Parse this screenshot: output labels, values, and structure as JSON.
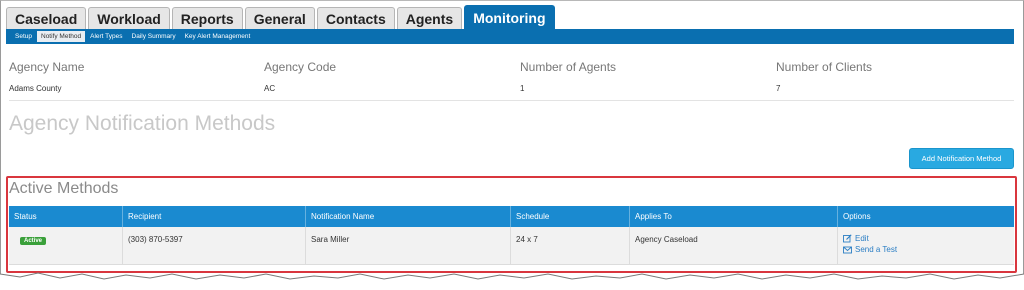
{
  "top_tabs": [
    {
      "label": "Caseload",
      "active": false
    },
    {
      "label": "Workload",
      "active": false
    },
    {
      "label": "Reports",
      "active": false
    },
    {
      "label": "General",
      "active": false
    },
    {
      "label": "Contacts",
      "active": false
    },
    {
      "label": "Agents",
      "active": false
    },
    {
      "label": "Monitoring",
      "active": true
    }
  ],
  "subnav": [
    {
      "label": "Setup",
      "active": false
    },
    {
      "label": "Notify Method",
      "active": true
    },
    {
      "label": "Alert Types",
      "active": false
    },
    {
      "label": "Daily Summary",
      "active": false
    },
    {
      "label": "Key Alert Management",
      "active": false
    }
  ],
  "agency": {
    "name_label": "Agency Name",
    "name_value": "Adams County",
    "code_label": "Agency Code",
    "code_value": "AC",
    "agents_label": "Number of Agents",
    "agents_value": "1",
    "clients_label": "Number of Clients",
    "clients_value": "7"
  },
  "page_heading": "Agency Notification Methods",
  "add_button_label": "Add Notification Method",
  "section_heading": "Active Methods",
  "table": {
    "headers": [
      "Status",
      "Recipient",
      "Notification Name",
      "Schedule",
      "Applies To",
      "Options"
    ],
    "rows": [
      {
        "status": "Active",
        "recipient": "(303) 870-5397",
        "notification_name": "Sara Miller",
        "schedule": "24 x 7",
        "applies_to": "Agency Caseload",
        "options": {
          "edit": "Edit",
          "send_test": "Send a Test"
        }
      }
    ]
  },
  "colors": {
    "nav_blue": "#0a6fb0",
    "header_blue": "#1a8ad0",
    "button_blue": "#29a9e1",
    "active_green": "#3aa03a",
    "highlight_red": "#d9363e"
  }
}
